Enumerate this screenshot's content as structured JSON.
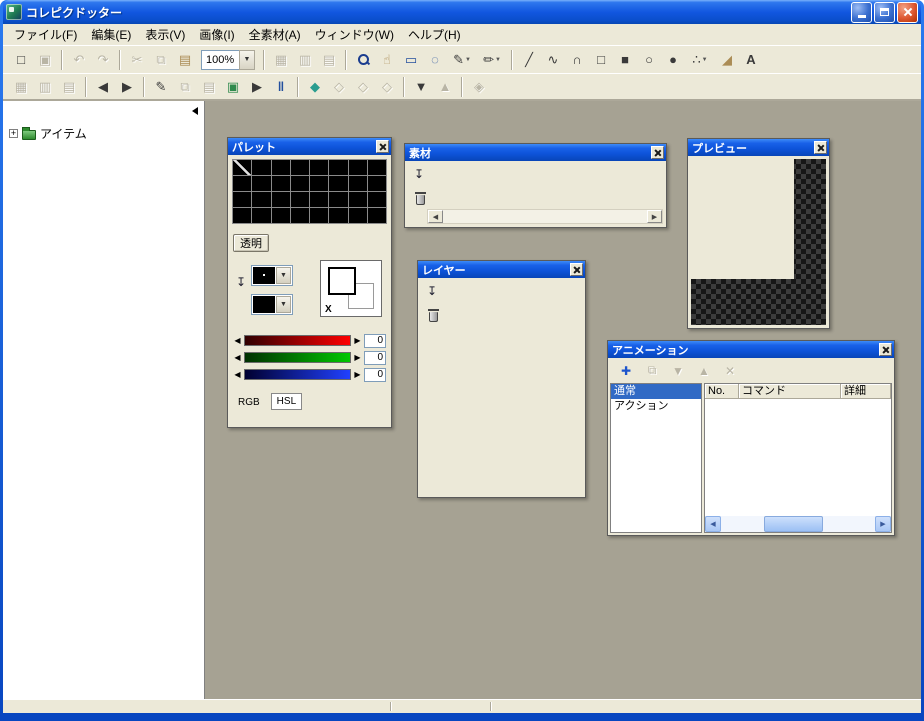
{
  "window": {
    "title": "コレピクドッター"
  },
  "menu": {
    "items": [
      "ファイル(F)",
      "編集(E)",
      "表示(V)",
      "画像(I)",
      "全素材(A)",
      "ウィンドウ(W)",
      "ヘルプ(H)"
    ]
  },
  "toolbar": {
    "zoom_value": "100%"
  },
  "icons": {
    "dropdown": "▼",
    "left": "◀",
    "right": "▶",
    "up": "▲",
    "down": "▼",
    "import": "↧",
    "new_file": "□",
    "save": "▣",
    "undo": "↶",
    "redo": "↷",
    "cut": "✂",
    "copy": "⧉",
    "paste": "▤",
    "grid_small": "▦",
    "grid_medium": "▥",
    "grid_large": "▤",
    "hand": "☝",
    "marquee": "▭",
    "lasso": "◌",
    "pen": "✎",
    "brush": "✏",
    "line": "╱",
    "polyline": "∿",
    "curve": "∩",
    "rect": "□",
    "rect_fill": "■",
    "ellipse": "○",
    "ellipse_fill": "●",
    "spray": "∴",
    "fill": "◢",
    "text": "A",
    "tile1": "▦",
    "tile2": "▥",
    "tile3": "▤",
    "frame_edit": "✎",
    "frame_copy": "⧉",
    "frame_paste": "▤",
    "frame_import": "▣",
    "play": "▶",
    "pause": "‖",
    "key_solid": "◆",
    "key_outline": "◇",
    "link": "◈",
    "anim_add": "✚",
    "anim_dup": "⧉",
    "anim_delete": "✕"
  },
  "tree": {
    "expander": "+",
    "root_label": "アイテム"
  },
  "palette": {
    "title": "パレット",
    "transparent_button": "透明",
    "switcher_label": "X",
    "r_value": "0",
    "g_value": "0",
    "b_value": "0",
    "tab_rgb": "RGB",
    "tab_hsl": "HSL"
  },
  "material": {
    "title": "素材"
  },
  "preview": {
    "title": "プレビュー"
  },
  "layer": {
    "title": "レイヤー"
  },
  "animation": {
    "title": "アニメーション",
    "list_items": [
      "通常",
      "アクション"
    ],
    "selected_item": "通常",
    "columns": [
      "No.",
      "コマンド",
      "詳細"
    ]
  },
  "colors": {
    "titlebar_blue": "#0853DD",
    "selection_blue": "#316AC5",
    "workspace_gray": "#A6A293",
    "window_beige": "#ECE9D8"
  }
}
